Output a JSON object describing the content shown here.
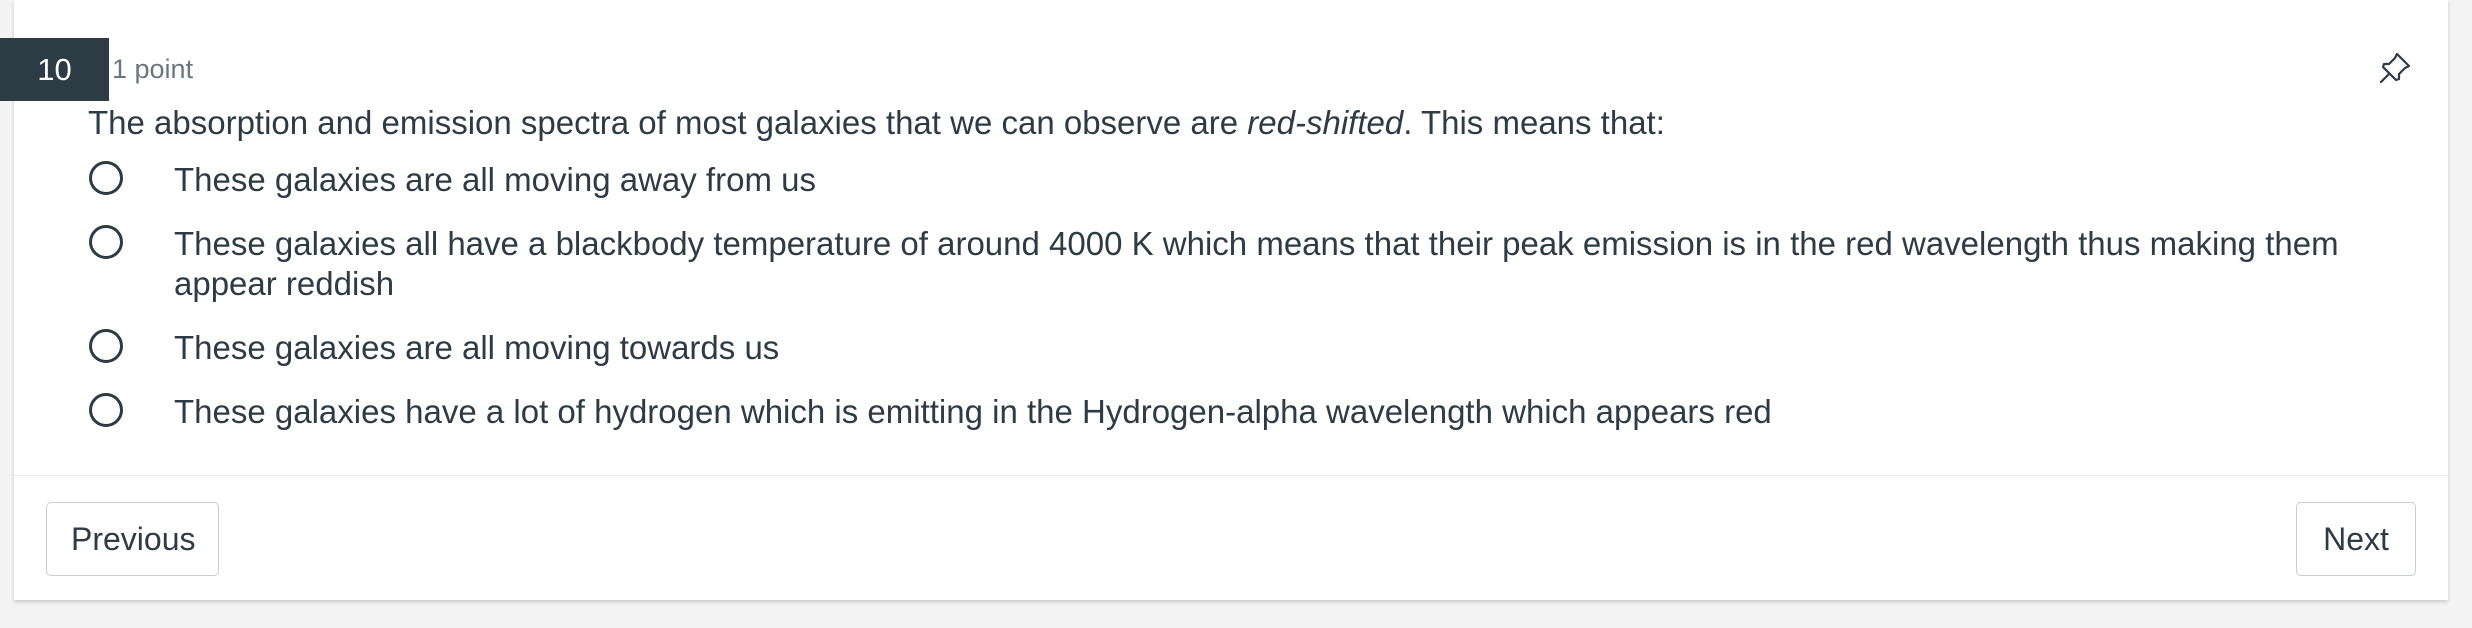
{
  "question": {
    "number": "10",
    "points": "1 point",
    "text_before": "The absorption and emission spectra of most galaxies that we can observe are ",
    "text_emphasis": "red-shifted",
    "text_after": ". This means that:"
  },
  "options": [
    {
      "label": "These galaxies are all moving away from us",
      "selected": false
    },
    {
      "label": "These galaxies all have a blackbody temperature of around 4000 K which means that their peak emission is in the red wavelength thus making them appear reddish",
      "selected": false
    },
    {
      "label": "These galaxies are all moving towards us",
      "selected": false
    },
    {
      "label": "These galaxies have a lot of hydrogen which is emitting in the Hydrogen-alpha wavelength which appears red",
      "selected": false
    }
  ],
  "icons": {
    "pin": "pin-icon"
  },
  "navigation": {
    "previous_label": "Previous",
    "next_label": "Next"
  },
  "colors": {
    "number_badge_bg": "#2d3b45",
    "text": "#2d3b45",
    "muted_text": "#6b7780"
  }
}
